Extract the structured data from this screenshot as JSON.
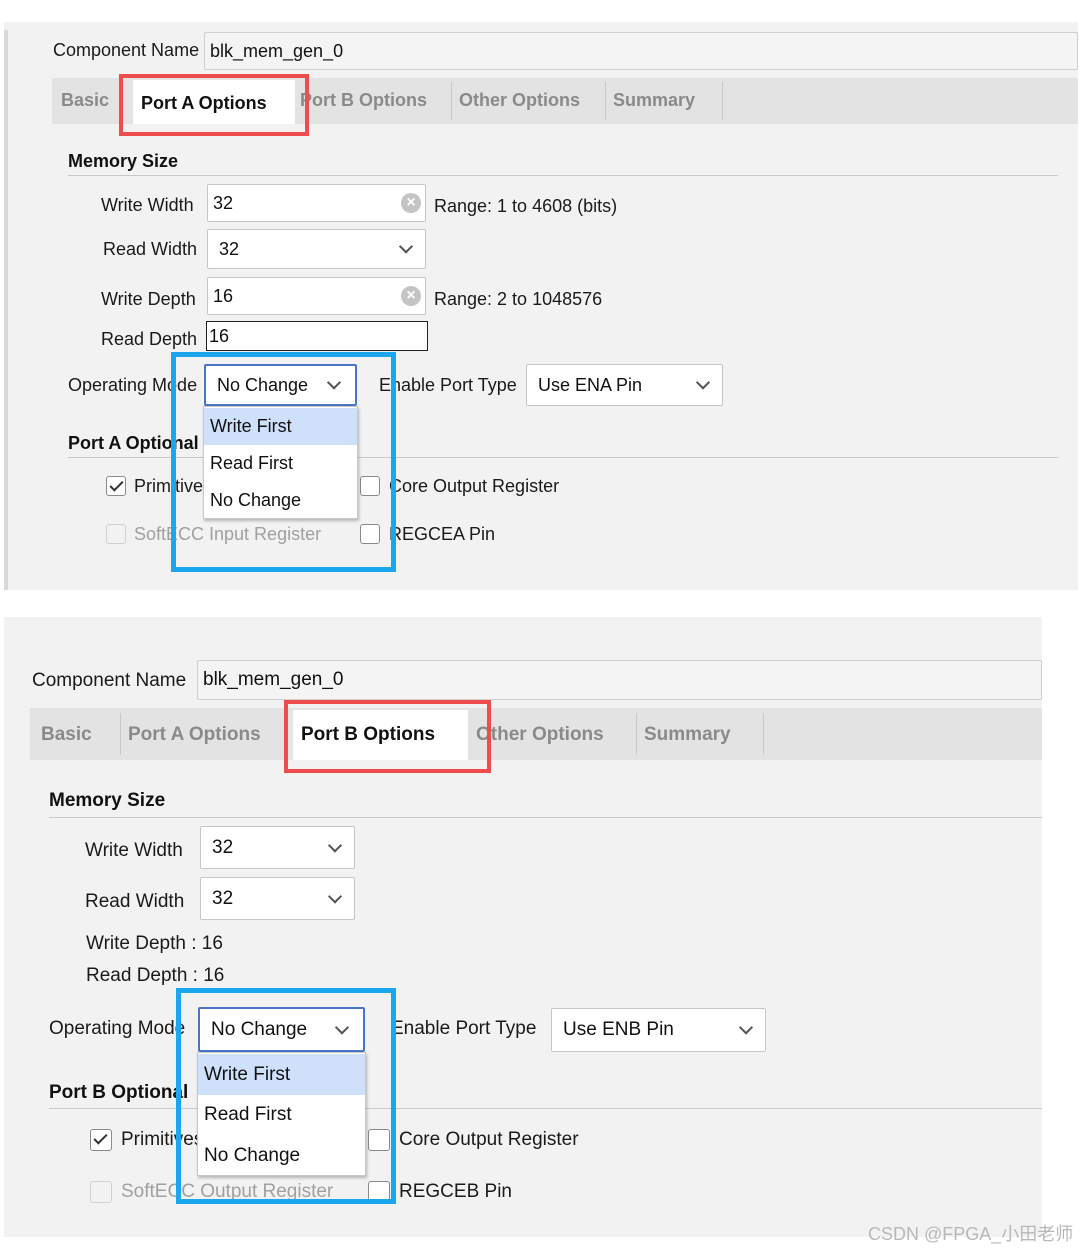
{
  "top": {
    "component_name_label": "Component Name",
    "component_name_value": "blk_mem_gen_0",
    "tabs": [
      "Basic",
      "Port A Options",
      "Port B Options",
      "Other Options",
      "Summary"
    ],
    "active_tab": "Port A Options",
    "memory_size_title": "Memory Size",
    "write_width_label": "Write Width",
    "write_width_value": "32",
    "write_width_range": "Range: 1 to 4608 (bits)",
    "read_width_label": "Read Width",
    "read_width_value": "32",
    "write_depth_label": "Write Depth",
    "write_depth_value": "16",
    "write_depth_range": "Range: 2 to 1048576",
    "read_depth_label": "Read Depth",
    "read_depth_value": "16",
    "operating_mode_label": "Operating Mode",
    "operating_mode_value": "No Change",
    "enable_port_type_label": "Enable Port Type",
    "enable_port_type_value": "Use ENA Pin",
    "optional_title": "Port A Optional",
    "primitives_label": "Primitives",
    "core_output_label": "Core Output Register",
    "softecc_label": "SoftECC Input Register",
    "regce_label": "REGCEA Pin",
    "dropdown_options": [
      "Write First",
      "Read First",
      "No Change"
    ],
    "highlighted_option": "Write First"
  },
  "bottom": {
    "component_name_label": "Component Name",
    "component_name_value": "blk_mem_gen_0",
    "tabs": [
      "Basic",
      "Port A Options",
      "Port B Options",
      "Other Options",
      "Summary"
    ],
    "active_tab": "Port B Options",
    "memory_size_title": "Memory Size",
    "write_width_label": "Write Width",
    "write_width_value": "32",
    "read_width_label": "Read Width",
    "read_width_value": "32",
    "write_depth_text": "Write Depth : 16",
    "read_depth_text": "Read Depth : 16",
    "operating_mode_label": "Operating Mode",
    "operating_mode_value": "No Change",
    "enable_port_type_label": "Enable Port Type",
    "enable_port_type_value": "Use ENB Pin",
    "optional_title": "Port B Optional",
    "primitives_label": "Primitives",
    "core_output_label": "Core Output Register",
    "softecc_label": "SoftECC Output Register",
    "regce_label": "REGCEB Pin",
    "dropdown_options": [
      "Write First",
      "Read First",
      "No Change"
    ],
    "highlighted_option": "Write First"
  },
  "watermark": "CSDN @FPGA_小田老师",
  "colors": {
    "red_highlight": "#ee4d4d",
    "blue_highlight": "#1da6f0",
    "dropdown_highlight": "#cfe0fb",
    "select_border": "#4a74c9"
  }
}
